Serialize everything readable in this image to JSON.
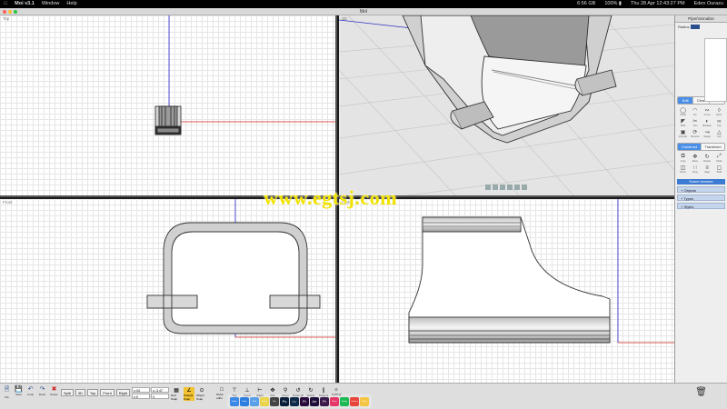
{
  "menubar": {
    "app": "Moi v3.1",
    "items": [
      "Window",
      "Help"
    ],
    "status": [
      "6:56 GB",
      "100% ▮",
      "Thu 28 Apr  12:43:27 PM",
      "Eden Ourazu"
    ]
  },
  "window": {
    "title": "MoI"
  },
  "viewports": {
    "top": {
      "label": "Top"
    },
    "perspective": {
      "label": "3D"
    },
    "front": {
      "label": "Front"
    },
    "right": {
      "label": "Right"
    }
  },
  "watermark": "www.egtsj.com",
  "panel": {
    "header": "Pipe/Varnalise",
    "radius_label": "Radius",
    "draw_tabs": [
      "Edit",
      "Clear",
      "Select"
    ],
    "draw_tools": [
      {
        "label": "Circle",
        "icon": "circle-icon"
      },
      {
        "label": "Arc",
        "icon": "arc-icon"
      },
      {
        "label": "Curve",
        "icon": "curve-icon"
      },
      {
        "label": "More",
        "icon": "more-icon"
      },
      {
        "label": "Fillet",
        "icon": "fillet-icon"
      },
      {
        "label": "Trim",
        "icon": "trim-icon"
      },
      {
        "label": "Boolean",
        "icon": "boolean-icon"
      },
      {
        "label": "Join",
        "icon": "join-icon"
      },
      {
        "label": "Extrude",
        "icon": "extrude-icon"
      },
      {
        "label": "Revolve",
        "icon": "revolve-icon"
      },
      {
        "label": "Sweep",
        "icon": "sweep-icon"
      },
      {
        "label": "Loft",
        "icon": "loft-icon"
      }
    ],
    "construct_tabs": [
      "Construct",
      "Transform"
    ],
    "construct_tools": [
      {
        "label": "Copy",
        "icon": "copy-icon"
      },
      {
        "label": "Move",
        "icon": "move-icon"
      },
      {
        "label": "Rotate",
        "icon": "rotate-icon"
      },
      {
        "label": "Scale",
        "icon": "scale-icon"
      },
      {
        "label": "Mirror",
        "icon": "mirror-icon"
      },
      {
        "label": "Array",
        "icon": "array-icon"
      },
      {
        "label": "Align",
        "icon": "align-icon"
      },
      {
        "label": "Shell",
        "icon": "shell-icon"
      }
    ],
    "browser_title": "Scene browser",
    "sections": [
      "Objects",
      "Types",
      "Styles"
    ]
  },
  "toolbar": {
    "file_tools": [
      {
        "label": "File",
        "icon": "file-icon"
      },
      {
        "label": "Save",
        "icon": "save-icon"
      },
      {
        "label": "Undo",
        "icon": "undo-icon"
      },
      {
        "label": "Redo",
        "icon": "redo-icon"
      },
      {
        "label": "Delete",
        "icon": "delete-icon"
      }
    ],
    "view_buttons": [
      "Split",
      "3D",
      "Top",
      "Front",
      "Right"
    ],
    "coords": [
      "x:34",
      "y:-3.47",
      "z:0",
      "0"
    ],
    "snap_tools": [
      "Grid Snap",
      "Straight Snap",
      "Object Snap"
    ],
    "bottom_tools": [
      "Show ortho",
      "Top",
      "Front",
      "Right",
      "Pan",
      "Zoom",
      "Reset all",
      "Rotate",
      "Tangent",
      "Lighting"
    ]
  },
  "dock": [
    "Finder",
    "Safari",
    "Mail",
    "Photos",
    "Moi",
    "Ps",
    "Lr",
    "Pr",
    "Ae",
    "Pr",
    "Music",
    "Spotify",
    "Chrome",
    "Notes"
  ]
}
